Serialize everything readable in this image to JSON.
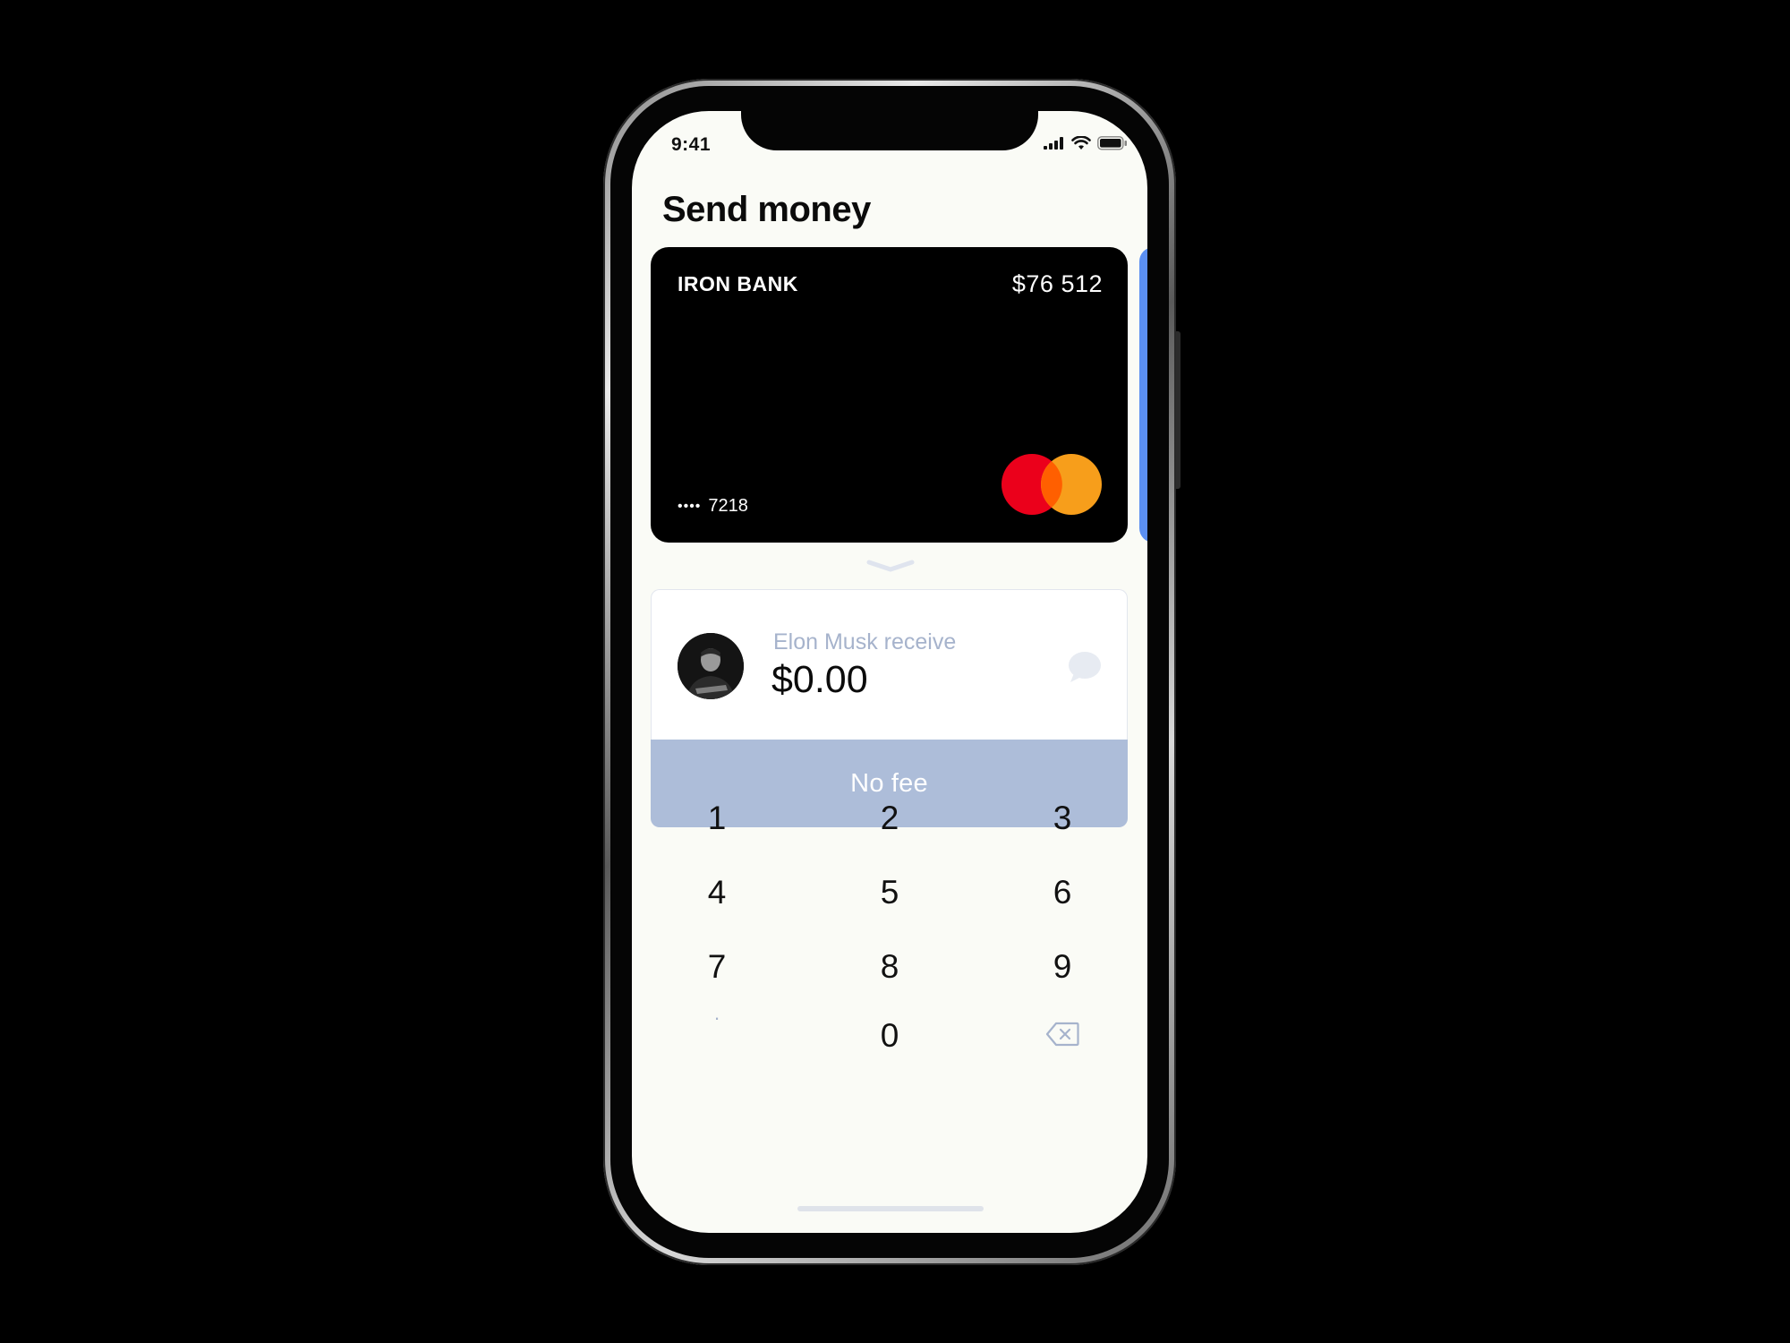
{
  "status_bar": {
    "time": "9:41",
    "icons": [
      "cellular-signal-icon",
      "wifi-icon",
      "battery-icon"
    ]
  },
  "page": {
    "title": "Send money"
  },
  "card": {
    "bank_name": "IRON BANK",
    "balance": "$76 512",
    "masked_dots": "••••",
    "last_four": "7218",
    "network_icon": "mastercard-logo",
    "colors": {
      "background": "#000000",
      "mastercard_red": "#eb001b",
      "mastercard_orange": "#f79e1b",
      "next_card": "#5b8ff2"
    }
  },
  "recipient": {
    "label": "Elon Musk receive",
    "amount": "$0.00",
    "message_icon": "chat-bubble-icon"
  },
  "fee": {
    "label": "No fee",
    "color": "#adbdd9"
  },
  "keypad": {
    "keys": [
      "1",
      "2",
      "3",
      "4",
      "5",
      "6",
      "7",
      "8",
      "9",
      ".",
      "0"
    ],
    "backspace_icon": "backspace-icon"
  }
}
